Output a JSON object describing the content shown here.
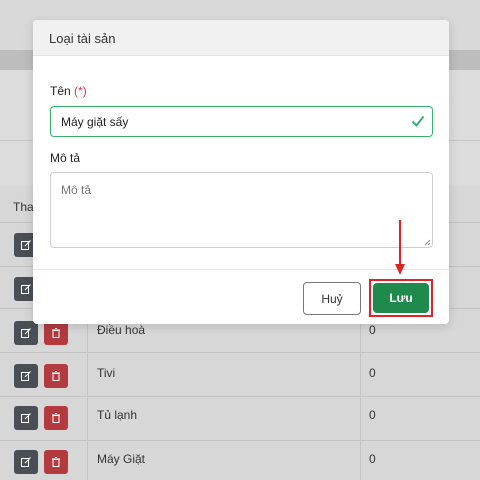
{
  "modal": {
    "title": "Loại tài sản",
    "name_label": "Tên",
    "required_marker": "(*)",
    "name_value": "Máy giặt sấy",
    "desc_label": "Mô tả",
    "desc_placeholder": "Mô tả",
    "cancel_label": "Huỷ",
    "save_label": "Lưu"
  },
  "table": {
    "header_partial": "Tha",
    "rows": [
      {
        "name": "Điều hoà",
        "value": "0"
      },
      {
        "name": "Tivi",
        "value": "0"
      },
      {
        "name": "Tủ lạnh",
        "value": "0"
      },
      {
        "name": "Máy Giặt",
        "value": "0"
      }
    ]
  },
  "colors": {
    "success": "#35b36a",
    "save_button": "#1f8a4c",
    "highlight": "#e02424",
    "delete_button": "#b33a3f",
    "edit_button": "#4a4f55"
  }
}
